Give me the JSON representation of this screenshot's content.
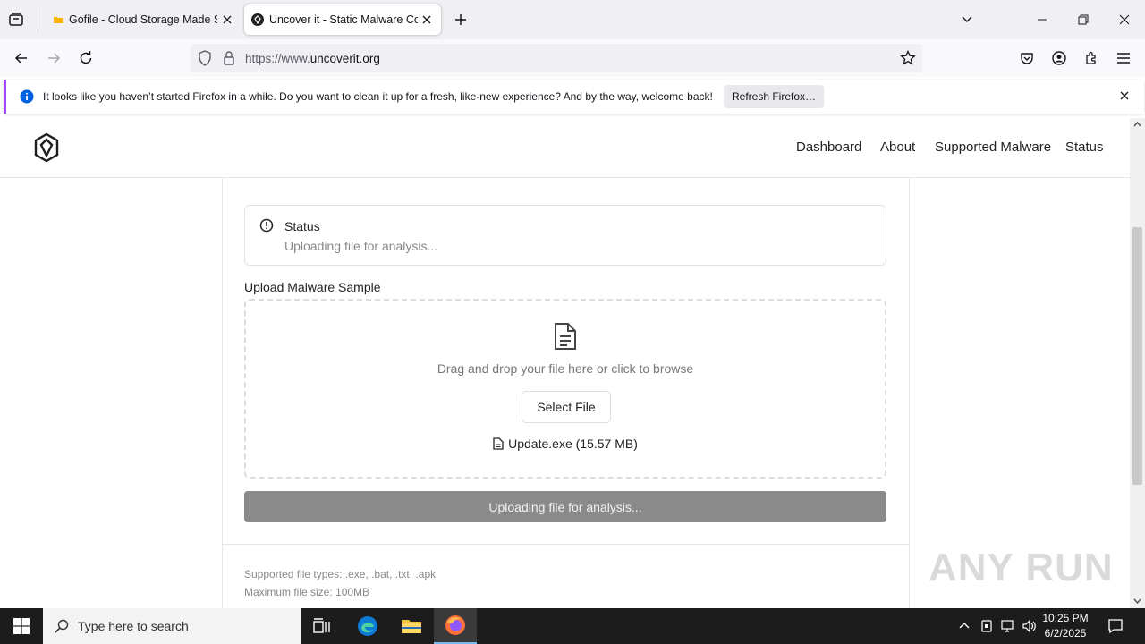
{
  "browser": {
    "tabs": [
      {
        "title": "Gofile - Cloud Storage Made Simple",
        "icon": "gofile-folder-icon",
        "active": false
      },
      {
        "title": "Uncover it - Static Malware Config",
        "icon": "uncoverit-logo-icon",
        "active": true
      }
    ],
    "url_prefix": "https://www.",
    "url_domain": "uncoverit.org",
    "notification": {
      "text": "It looks like you haven’t started Firefox in a while. Do you want to clean it up for a fresh, like-new experience? And by the way, welcome back!",
      "button": "Refresh Firefox…"
    }
  },
  "site": {
    "nav": [
      "Dashboard",
      "About",
      "Supported Malware",
      "Status"
    ],
    "status": {
      "title": "Status",
      "message": "Uploading file for analysis..."
    },
    "upload": {
      "label": "Upload Malware Sample",
      "drop_text": "Drag and drop your file here or click to browse",
      "select_button": "Select File",
      "file_name": "Update.exe (15.57 MB)",
      "submit_button": "Uploading file for analysis..."
    },
    "footer": {
      "supported_types": "Supported file types: .exe, .bat, .txt, .apk",
      "max_size": "Maximum file size: 100MB"
    }
  },
  "watermark": "ANY RUN",
  "taskbar": {
    "search_placeholder": "Type here to search",
    "time": "10:25 PM",
    "date": "6/2/2025"
  },
  "colors": {
    "notification_accent": "#a347ff",
    "upload_button": "#8a8a8a",
    "taskbar": "#1c1c1c"
  }
}
